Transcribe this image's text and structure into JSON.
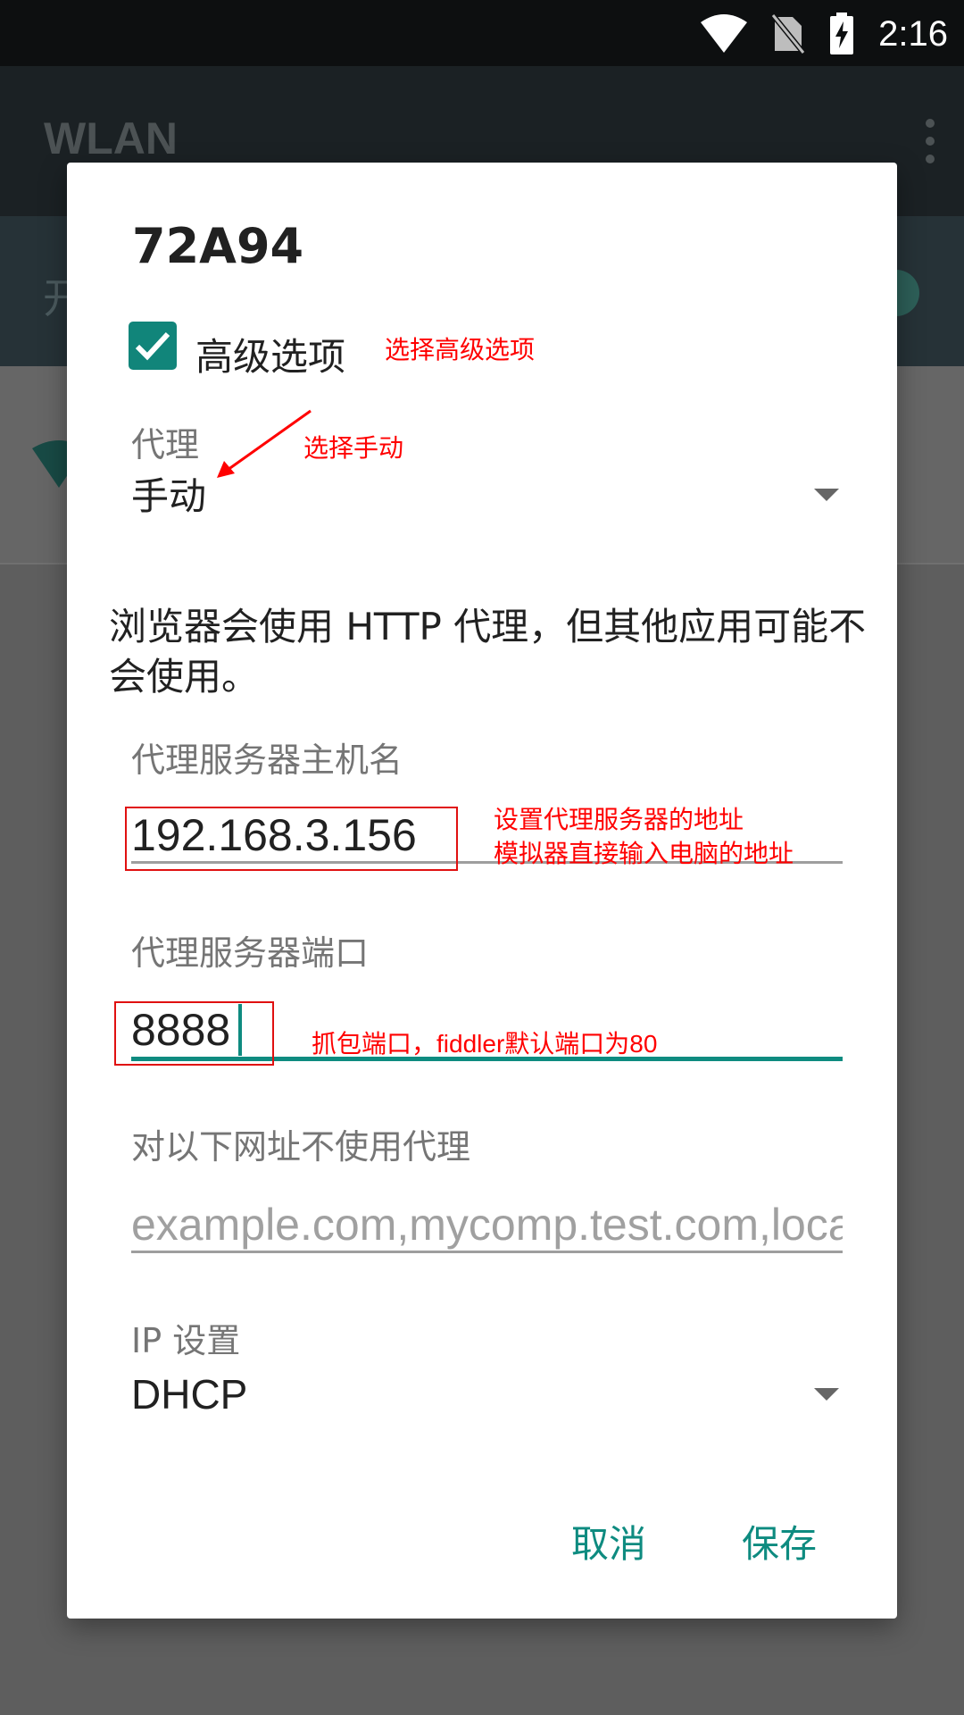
{
  "status_bar": {
    "time": "2:16",
    "icons": [
      "wifi-icon",
      "no-sim-icon",
      "battery-charging-icon"
    ]
  },
  "app_bar": {
    "title": "WLAN",
    "menu_icon": "overflow-menu-icon"
  },
  "switch_row": {
    "label": "开"
  },
  "dialog": {
    "title": "72A94",
    "advanced_checkbox": {
      "label": "高级选项",
      "checked": true
    },
    "proxy": {
      "label": "代理",
      "value": "手动"
    },
    "notice": "浏览器会使用 HTTP 代理，但其他应用可能不会使用。",
    "hostname": {
      "label": "代理服务器主机名",
      "value": "192.168.3.156"
    },
    "port": {
      "label": "代理服务器端口",
      "value": "8888"
    },
    "bypass": {
      "label": "对以下网址不使用代理",
      "placeholder": "example.com,mycomp.test.com,localhost"
    },
    "ip_settings": {
      "label": "IP 设置",
      "value": "DHCP"
    },
    "buttons": {
      "cancel": "取消",
      "save": "保存"
    }
  },
  "annotations": {
    "advanced": "选择高级选项",
    "manual": "选择手动",
    "host_line1": "设置代理服务器的地址",
    "host_line2": "模拟器直接输入电脑的地址",
    "port": "抓包端口，fiddler默认端口为80"
  },
  "colors": {
    "accent": "#0e8b80",
    "annotation": "#ff0000",
    "status_bar": "#0d0f10",
    "app_bar": "#1b2124"
  }
}
